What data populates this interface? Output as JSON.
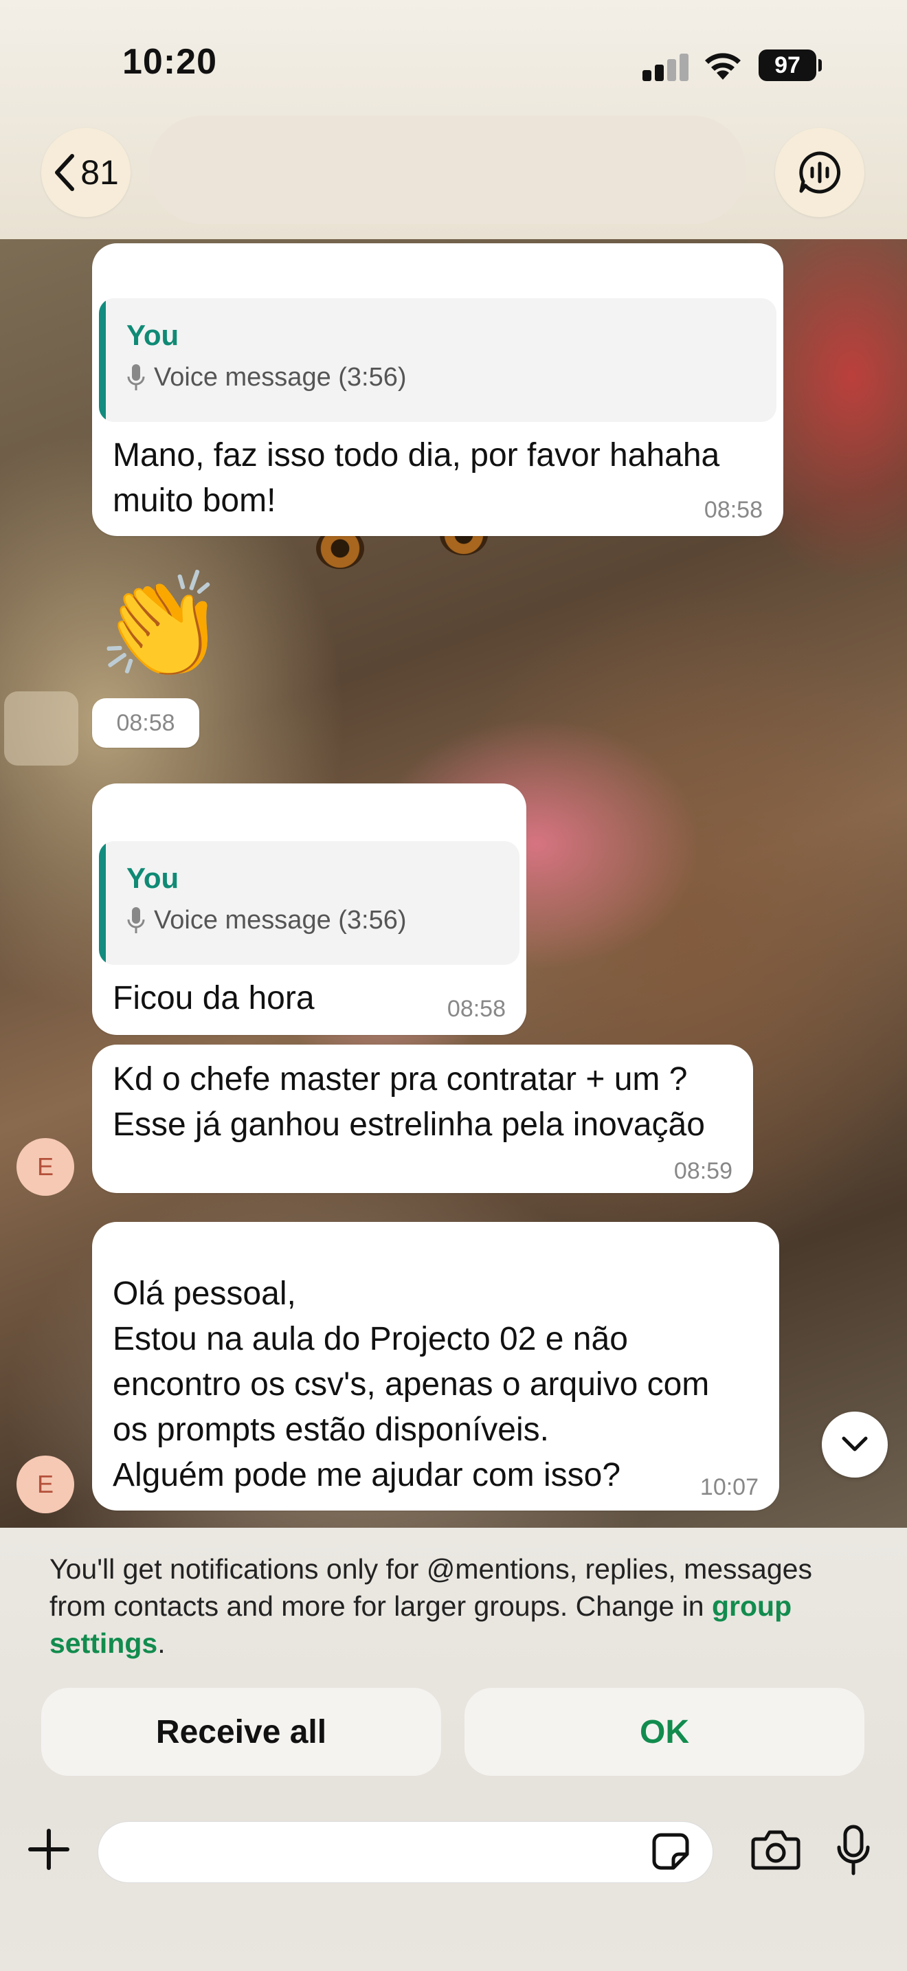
{
  "status_bar": {
    "time": "10:20",
    "battery": "97"
  },
  "header": {
    "back_count": "81"
  },
  "messages": [
    {
      "quote_author": "You",
      "quote_text": "Voice message (3:56)",
      "text": "Mano, faz isso todo dia, por favor hahaha\nmuito bom!",
      "time": "08:58"
    },
    {
      "emoji": "👏",
      "time": "08:58"
    },
    {
      "quote_author": "You",
      "quote_text": "Voice message (3:56)",
      "text": "Ficou da hora",
      "time": "08:58"
    },
    {
      "sender_initial": "E",
      "text": "Kd o chefe master pra contratar + um ?\nEsse já ganhou estrelinha pela inovação",
      "time": "08:59"
    },
    {
      "sender_initial": "E",
      "text": "Olá pessoal,\nEstou na aula do Projecto 02 e não\nencontro os csv's, apenas o arquivo com\nos prompts estão disponíveis.\nAlguém pode me ajudar com isso?",
      "time": "10:07"
    }
  ],
  "notice": {
    "text_before": "You'll get notifications only for @mentions, replies, messages from contacts and more for larger groups. Change in ",
    "link": "group settings",
    "text_after": "."
  },
  "buttons": {
    "receive_all": "Receive all",
    "ok": "OK"
  },
  "composer": {
    "value": "",
    "placeholder": ""
  },
  "colors": {
    "accent": "#128c4e",
    "quote_bar": "#128c7e",
    "avatar_bg": "#f6c9b4"
  },
  "icons": [
    "back-chevron-icon",
    "voice-chat-icon",
    "mic-icon",
    "chevron-down-icon",
    "plus-icon",
    "sticker-icon",
    "camera-icon",
    "microphone-icon"
  ]
}
